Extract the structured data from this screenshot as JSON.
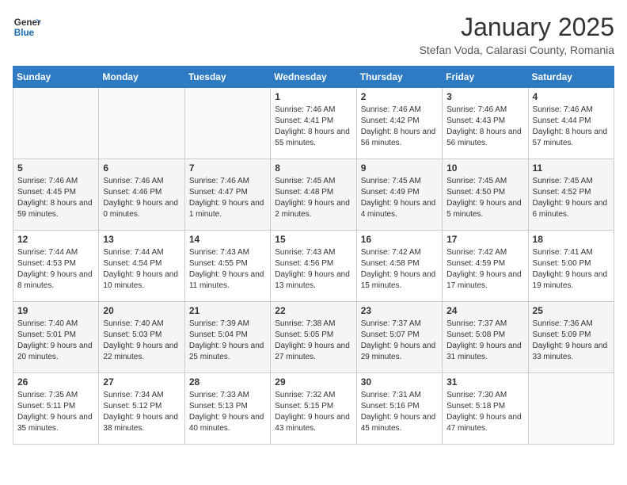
{
  "header": {
    "logo_line1": "General",
    "logo_line2": "Blue",
    "title": "January 2025",
    "subtitle": "Stefan Voda, Calarasi County, Romania"
  },
  "weekdays": [
    "Sunday",
    "Monday",
    "Tuesday",
    "Wednesday",
    "Thursday",
    "Friday",
    "Saturday"
  ],
  "weeks": [
    [
      {
        "day": "",
        "sunrise": "",
        "sunset": "",
        "daylight": ""
      },
      {
        "day": "",
        "sunrise": "",
        "sunset": "",
        "daylight": ""
      },
      {
        "day": "",
        "sunrise": "",
        "sunset": "",
        "daylight": ""
      },
      {
        "day": "1",
        "sunrise": "Sunrise: 7:46 AM",
        "sunset": "Sunset: 4:41 PM",
        "daylight": "Daylight: 8 hours and 55 minutes."
      },
      {
        "day": "2",
        "sunrise": "Sunrise: 7:46 AM",
        "sunset": "Sunset: 4:42 PM",
        "daylight": "Daylight: 8 hours and 56 minutes."
      },
      {
        "day": "3",
        "sunrise": "Sunrise: 7:46 AM",
        "sunset": "Sunset: 4:43 PM",
        "daylight": "Daylight: 8 hours and 56 minutes."
      },
      {
        "day": "4",
        "sunrise": "Sunrise: 7:46 AM",
        "sunset": "Sunset: 4:44 PM",
        "daylight": "Daylight: 8 hours and 57 minutes."
      }
    ],
    [
      {
        "day": "5",
        "sunrise": "Sunrise: 7:46 AM",
        "sunset": "Sunset: 4:45 PM",
        "daylight": "Daylight: 8 hours and 59 minutes."
      },
      {
        "day": "6",
        "sunrise": "Sunrise: 7:46 AM",
        "sunset": "Sunset: 4:46 PM",
        "daylight": "Daylight: 9 hours and 0 minutes."
      },
      {
        "day": "7",
        "sunrise": "Sunrise: 7:46 AM",
        "sunset": "Sunset: 4:47 PM",
        "daylight": "Daylight: 9 hours and 1 minute."
      },
      {
        "day": "8",
        "sunrise": "Sunrise: 7:45 AM",
        "sunset": "Sunset: 4:48 PM",
        "daylight": "Daylight: 9 hours and 2 minutes."
      },
      {
        "day": "9",
        "sunrise": "Sunrise: 7:45 AM",
        "sunset": "Sunset: 4:49 PM",
        "daylight": "Daylight: 9 hours and 4 minutes."
      },
      {
        "day": "10",
        "sunrise": "Sunrise: 7:45 AM",
        "sunset": "Sunset: 4:50 PM",
        "daylight": "Daylight: 9 hours and 5 minutes."
      },
      {
        "day": "11",
        "sunrise": "Sunrise: 7:45 AM",
        "sunset": "Sunset: 4:52 PM",
        "daylight": "Daylight: 9 hours and 6 minutes."
      }
    ],
    [
      {
        "day": "12",
        "sunrise": "Sunrise: 7:44 AM",
        "sunset": "Sunset: 4:53 PM",
        "daylight": "Daylight: 9 hours and 8 minutes."
      },
      {
        "day": "13",
        "sunrise": "Sunrise: 7:44 AM",
        "sunset": "Sunset: 4:54 PM",
        "daylight": "Daylight: 9 hours and 10 minutes."
      },
      {
        "day": "14",
        "sunrise": "Sunrise: 7:43 AM",
        "sunset": "Sunset: 4:55 PM",
        "daylight": "Daylight: 9 hours and 11 minutes."
      },
      {
        "day": "15",
        "sunrise": "Sunrise: 7:43 AM",
        "sunset": "Sunset: 4:56 PM",
        "daylight": "Daylight: 9 hours and 13 minutes."
      },
      {
        "day": "16",
        "sunrise": "Sunrise: 7:42 AM",
        "sunset": "Sunset: 4:58 PM",
        "daylight": "Daylight: 9 hours and 15 minutes."
      },
      {
        "day": "17",
        "sunrise": "Sunrise: 7:42 AM",
        "sunset": "Sunset: 4:59 PM",
        "daylight": "Daylight: 9 hours and 17 minutes."
      },
      {
        "day": "18",
        "sunrise": "Sunrise: 7:41 AM",
        "sunset": "Sunset: 5:00 PM",
        "daylight": "Daylight: 9 hours and 19 minutes."
      }
    ],
    [
      {
        "day": "19",
        "sunrise": "Sunrise: 7:40 AM",
        "sunset": "Sunset: 5:01 PM",
        "daylight": "Daylight: 9 hours and 20 minutes."
      },
      {
        "day": "20",
        "sunrise": "Sunrise: 7:40 AM",
        "sunset": "Sunset: 5:03 PM",
        "daylight": "Daylight: 9 hours and 22 minutes."
      },
      {
        "day": "21",
        "sunrise": "Sunrise: 7:39 AM",
        "sunset": "Sunset: 5:04 PM",
        "daylight": "Daylight: 9 hours and 25 minutes."
      },
      {
        "day": "22",
        "sunrise": "Sunrise: 7:38 AM",
        "sunset": "Sunset: 5:05 PM",
        "daylight": "Daylight: 9 hours and 27 minutes."
      },
      {
        "day": "23",
        "sunrise": "Sunrise: 7:37 AM",
        "sunset": "Sunset: 5:07 PM",
        "daylight": "Daylight: 9 hours and 29 minutes."
      },
      {
        "day": "24",
        "sunrise": "Sunrise: 7:37 AM",
        "sunset": "Sunset: 5:08 PM",
        "daylight": "Daylight: 9 hours and 31 minutes."
      },
      {
        "day": "25",
        "sunrise": "Sunrise: 7:36 AM",
        "sunset": "Sunset: 5:09 PM",
        "daylight": "Daylight: 9 hours and 33 minutes."
      }
    ],
    [
      {
        "day": "26",
        "sunrise": "Sunrise: 7:35 AM",
        "sunset": "Sunset: 5:11 PM",
        "daylight": "Daylight: 9 hours and 35 minutes."
      },
      {
        "day": "27",
        "sunrise": "Sunrise: 7:34 AM",
        "sunset": "Sunset: 5:12 PM",
        "daylight": "Daylight: 9 hours and 38 minutes."
      },
      {
        "day": "28",
        "sunrise": "Sunrise: 7:33 AM",
        "sunset": "Sunset: 5:13 PM",
        "daylight": "Daylight: 9 hours and 40 minutes."
      },
      {
        "day": "29",
        "sunrise": "Sunrise: 7:32 AM",
        "sunset": "Sunset: 5:15 PM",
        "daylight": "Daylight: 9 hours and 43 minutes."
      },
      {
        "day": "30",
        "sunrise": "Sunrise: 7:31 AM",
        "sunset": "Sunset: 5:16 PM",
        "daylight": "Daylight: 9 hours and 45 minutes."
      },
      {
        "day": "31",
        "sunrise": "Sunrise: 7:30 AM",
        "sunset": "Sunset: 5:18 PM",
        "daylight": "Daylight: 9 hours and 47 minutes."
      },
      {
        "day": "",
        "sunrise": "",
        "sunset": "",
        "daylight": ""
      }
    ]
  ]
}
